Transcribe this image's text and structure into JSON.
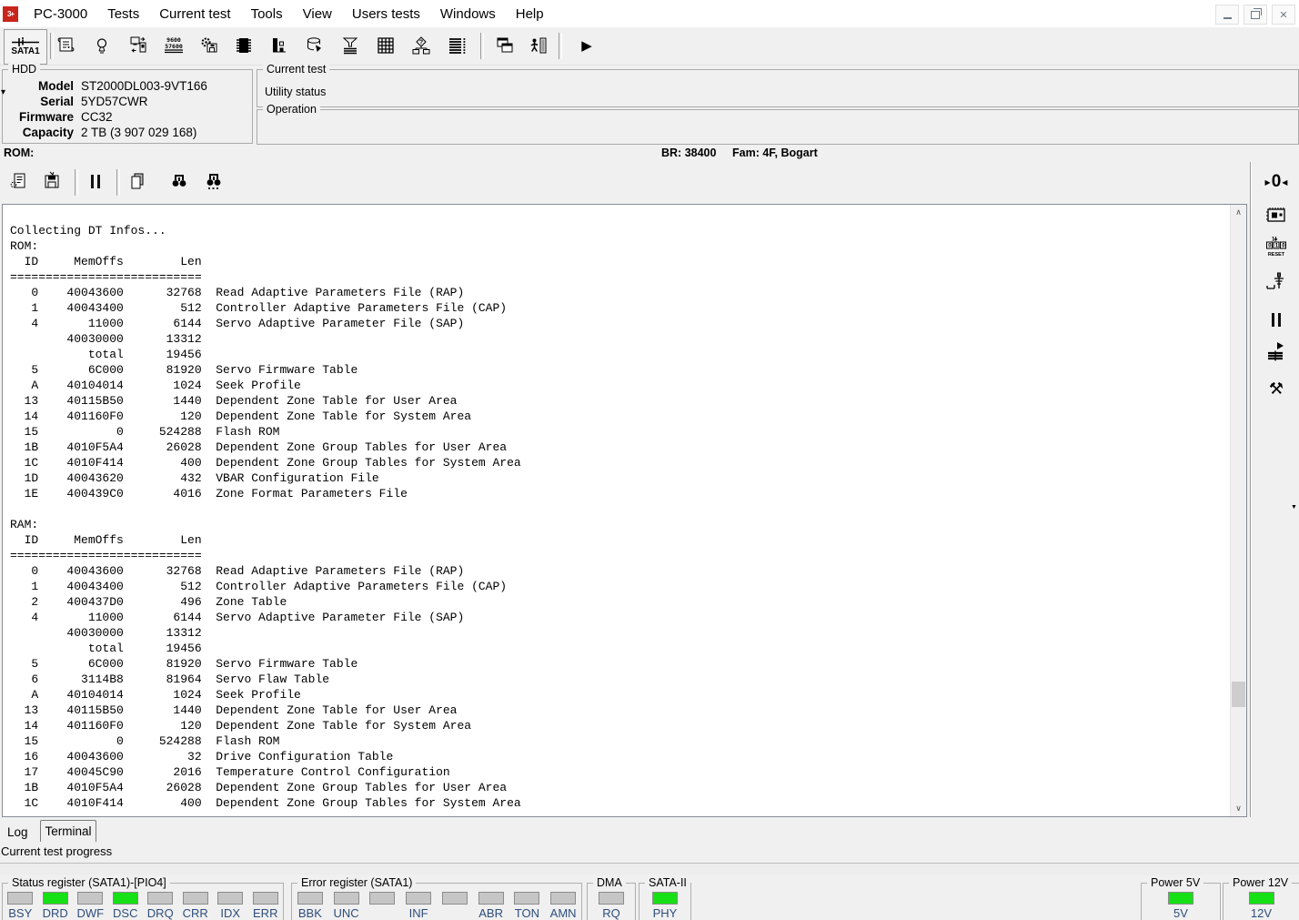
{
  "menu": {
    "items": [
      "PC-3000",
      "Tests",
      "Current test",
      "Tools",
      "View",
      "Users tests",
      "Windows",
      "Help"
    ]
  },
  "logo_text": "3+",
  "window_controls": {
    "close_glyph": "✕"
  },
  "main_toolbar": {
    "sata_button_label": "SATA1"
  },
  "hdd_panel": {
    "title": "HDD",
    "fields": [
      {
        "label": "Model",
        "value": "ST2000DL003-9VT166"
      },
      {
        "label": "Serial",
        "value": "5YD57CWR"
      },
      {
        "label": "Firmware",
        "value": "CC32"
      },
      {
        "label": "Capacity",
        "value": "2 TB (3 907 029 168)"
      }
    ]
  },
  "current_test_panel": {
    "title": "Current test",
    "status": "Utility status"
  },
  "operation_panel": {
    "title": "Operation"
  },
  "rom_statusline": {
    "rom": "ROM:",
    "br": "BR: 38400",
    "fam": "Fam: 4F, Bogart"
  },
  "terminal": {
    "lines": [
      "Collecting DT Infos...",
      "ROM:",
      "  ID     MemOffs        Len",
      "===========================",
      "   0    40043600      32768  Read Adaptive Parameters File (RAP)",
      "   1    40043400        512  Controller Adaptive Parameters File (CAP)",
      "   4       11000       6144  Servo Adaptive Parameter File (SAP)",
      "        40030000      13312",
      "           total      19456",
      "   5       6C000      81920  Servo Firmware Table",
      "   A    40104014       1024  Seek Profile",
      "  13    40115B50       1440  Dependent Zone Table for User Area",
      "  14    401160F0        120  Dependent Zone Table for System Area",
      "  15           0     524288  Flash ROM",
      "  1B    4010F5A4      26028  Dependent Zone Group Tables for User Area",
      "  1C    4010F414        400  Dependent Zone Group Tables for System Area",
      "  1D    40043620        432  VBAR Configuration File",
      "  1E    400439C0       4016  Zone Format Parameters File",
      "",
      "RAM:",
      "  ID     MemOffs        Len",
      "===========================",
      "   0    40043600      32768  Read Adaptive Parameters File (RAP)",
      "   1    40043400        512  Controller Adaptive Parameters File (CAP)",
      "   2    400437D0        496  Zone Table",
      "   4       11000       6144  Servo Adaptive Parameter File (SAP)",
      "        40030000      13312",
      "           total      19456",
      "   5       6C000      81920  Servo Firmware Table",
      "   6      3114B8      81964  Servo Flaw Table",
      "   A    40104014       1024  Seek Profile",
      "  13    40115B50       1440  Dependent Zone Table for User Area",
      "  14    401160F0        120  Dependent Zone Table for System Area",
      "  15           0     524288  Flash ROM",
      "  16    40043600         32  Drive Configuration Table",
      "  17    40045C90       2016  Temperature Control Configuration",
      "  1B    4010F5A4      26028  Dependent Zone Group Tables for User Area",
      "  1C    4010F414        400  Dependent Zone Group Tables for System Area"
    ]
  },
  "tabs": {
    "log": "Log",
    "terminal": "Terminal",
    "active": "Terminal"
  },
  "progress": {
    "label": "Current test progress"
  },
  "status_bar": {
    "status_register": {
      "title": "Status register (SATA1)-[PIO4]",
      "leds": [
        {
          "label": "BSY",
          "state": "off"
        },
        {
          "label": "DRD",
          "state": "on"
        },
        {
          "label": "DWF",
          "state": "off"
        },
        {
          "label": "DSC",
          "state": "on"
        },
        {
          "label": "DRQ",
          "state": "off"
        },
        {
          "label": "CRR",
          "state": "off"
        },
        {
          "label": "IDX",
          "state": "off"
        },
        {
          "label": "ERR",
          "state": "off"
        }
      ]
    },
    "error_register": {
      "title": "Error register (SATA1)",
      "leds": [
        {
          "label": "BBK",
          "state": "off"
        },
        {
          "label": "UNC",
          "state": "off"
        },
        {
          "label": "",
          "state": "off"
        },
        {
          "label": "INF",
          "state": "off"
        },
        {
          "label": "",
          "state": "off"
        },
        {
          "label": "ABR",
          "state": "off"
        },
        {
          "label": "TON",
          "state": "off"
        },
        {
          "label": "AMN",
          "state": "off"
        }
      ]
    },
    "dma": {
      "title": "DMA",
      "leds": [
        {
          "label": "RQ",
          "state": "off"
        }
      ]
    },
    "sata2": {
      "title": "SATA-II",
      "leds": [
        {
          "label": "PHY",
          "state": "on"
        }
      ]
    },
    "power5": {
      "title": "Power 5V",
      "leds": [
        {
          "label": "5V",
          "state": "on"
        }
      ]
    },
    "power12": {
      "title": "Power 12V",
      "leds": [
        {
          "label": "12V",
          "state": "on"
        }
      ]
    }
  },
  "icons": {
    "run": "▶",
    "tools": "⚒",
    "tri_right": "▶",
    "tri_left": "◀",
    "zero": "0",
    "dropdown_small": "▼",
    "scroll_up": "∧",
    "scroll_down": "∨",
    "expander": "▾"
  },
  "colors": {
    "led_on": "#16e016",
    "led_off": "#c6c6c6",
    "led_label": "#2e4d7b",
    "logo_red": "#c9241c"
  }
}
